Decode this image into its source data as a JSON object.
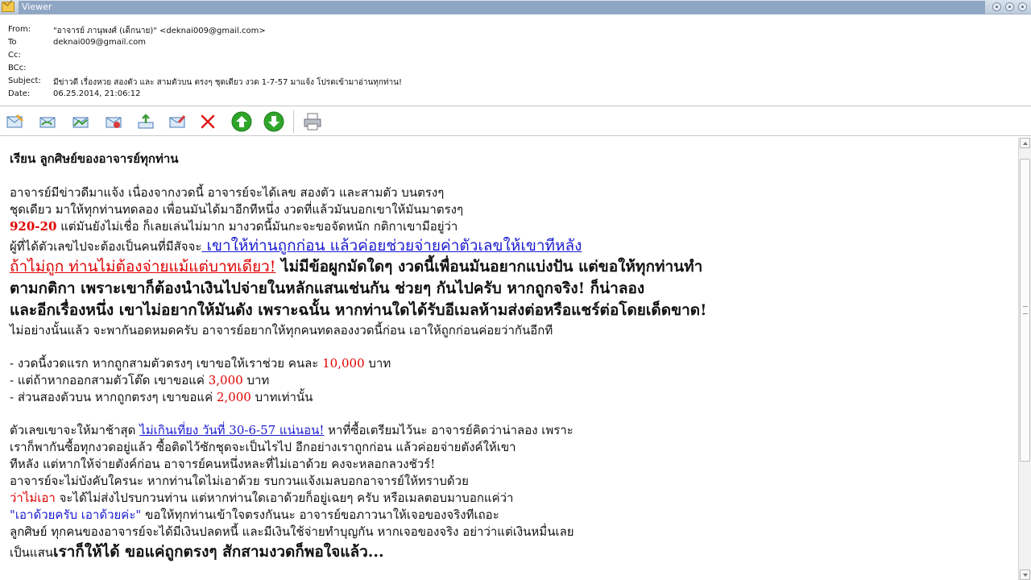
{
  "window": {
    "title": "Viewer"
  },
  "header": {
    "from_label": "From:",
    "from_value": "\"อาจารย์ ภานุพงศ์ (เด็กนาย)\" <deknai009@gmail.com>",
    "to_label": "To",
    "to_value": "deknai009@gmail.com",
    "cc_label": "Cc:",
    "cc_value": "",
    "bcc_label": "BCc:",
    "bcc_value": "",
    "subject_label": "Subject:",
    "subject_value": "มีข่าวดี เรื่องหวย สองตัว และ สามตัวบน ตรงๆ ชุดเดียว งวด 1-7-57 มาแจ้ง โปรดเข้ามาอ่านทุกท่าน!",
    "date_label": "Date:",
    "date_value": "06.25.2014, 21:06:12"
  },
  "toolbar": {
    "items": [
      {
        "icon": "compose-icon"
      },
      {
        "icon": "reply-icon"
      },
      {
        "icon": "reply-all-icon"
      },
      {
        "icon": "forward-icon"
      },
      {
        "icon": "export-icon"
      },
      {
        "icon": "edit-icon"
      },
      {
        "icon": "delete-icon"
      },
      {
        "icon": "previous-up-icon"
      },
      {
        "icon": "next-down-icon"
      },
      {
        "icon": "print-icon"
      }
    ],
    "colors": {
      "delete": "#e01818",
      "nav_green": "#2fa52a"
    }
  },
  "body": {
    "greeting": "เรียน  ลูกศิษย์ของอาจารย์ทุกท่าน",
    "p1_line1": "อาจารย์มีข่าวดีมาแจ้ง เนื่องจากงวดนี้ อาจารย์จะได้เลข สองตัว และสามตัว บนตรงๆ",
    "p1_line2": "ชุดเดียว มาให้ทุกท่านทดลอง เพื่อนมันได้มาอีกทีหนึ่ง งวดที่แล้วมันบอกเขาให้มันมาตรงๆ",
    "p1_line3_num": "920-20",
    "p1_line3_rest": "  แต่มันยังไม่เชื่อ ก็เลยเล่นไม่มาก มางวดนี้มันกะจะขอจัดหนัก กติกาเขามีอยู่ว่า",
    "p1_line4_a": "ผู้ที่ได้ตัวเลขไปจะต้องเป็นคนที่มีสัจจะ",
    "p1_line4_b": " เขาให้ท่านถูกก่อน แล้วค่อยช่วยจ่ายค่าตัวเลขให้เขาทีหลัง",
    "p1_line5_a": "ถ้าไม่ถูก ท่านไม่ต้องจ่ายแม้แต่บาทเดียว!",
    "p1_line5_b": "  ไม่มีข้อผูกมัดใดๆ งวดนี้เพื่อนมันอยากแบ่งปัน แต่ขอให้ทุกท่านทำ",
    "p1_line6": "ตามกติกา เพราะเขาก็ต้องนำเงินไปจ่ายในหลักแสนเช่นกัน ช่วยๆ กันไปครับ หากถูกจริง! ก็น่าลอง",
    "p1_line7": "และอีกเรื่องหนึ่ง เขาไม่อยากให้มันดัง เพราะฉนั้น หากท่านใดได้รับอีเมลห้ามส่งต่อหรือแชร์ต่อโดยเด็ดขาด!",
    "p1_line8": "ไม่อย่างนั้นแล้ว จะพากันอดหมดครับ  อาจารย์อยากให้ทุกคนทดลองงวดนี้ก่อน เอาให้ถูกก่อนค่อยว่ากันอีกที",
    "b1_a": "- งวดนี้งวดแรก หากถูกสามตัวตรงๆ เขาขอให้เราช่วย คนละ ",
    "b1_num": "10,000",
    "b1_b": " บาท",
    "b2_a": "- แต่ถ้าหากออกสามตัวโต๊ด เขาขอแค่ ",
    "b2_num": "3,000",
    "b2_b": " บาท",
    "b3_a": "- ส่วนสองตัวบน หากถูกตรงๆ เขาขอแค่ ",
    "b3_num": "2,000",
    "b3_b": " บาทเท่านั้น",
    "p3_line1_a": "ตัวเลขเขาจะให้มาช้าสุด ",
    "p3_line1_link": "ไม่เกินเที่ยง วันที่ 30-6-57 แน่นอน!",
    "p3_line1_b": "  หาที่ซื้อเตรียมไว้นะ อาจารย์คิดว่าน่าลอง เพราะ",
    "p3_line2": "เราก็พากันซื้อทุกงวดอยู่แล้ว ซื้อติดไว้ซักชุดจะเป็นไรไป อีกอย่างเราถูกก่อน แล้วค่อยจ่ายตังค์ให้เขา",
    "p3_line3": "ทีหลัง  แต่หากให้จ่ายตังค์ก่อน อาจารย์คนหนึ่งหละที่ไม่เอาด้วย คงจะหลอกลวงชัวร์!",
    "p3_line4": "อาจารย์จะไม่บังคับใครนะ หากท่านใดไม่เอาด้วย รบกวนแจ้งเมลบอกอาจารย์ให้ทราบด้วย",
    "p3_line5_a": "ว่าไม่เอา",
    "p3_line5_b": " จะได้ไม่ส่งไปรบกวนท่าน  แต่หากท่านใดเอาด้วยก็อยู่เฉยๆ ครับ หรือเมลตอบมาบอกแค่ว่า",
    "p3_line6_a": "\"เอาด้วยครับ เอาด้วยค่ะ\"",
    "p3_line6_b": "  ขอให้ทุกท่านเข้าใจตรงกันนะ   อาจารย์ขอภาวนาให้เจอของจริงทีเถอะ",
    "p3_line7": "ลูกศิษย์ ทุกคนของอาจารย์จะได้มีเงินปลดหนี้ และมีเงินใช้จ่ายทำบุญกัน หากเจอของจริง อย่าว่าแต่เงินหมื่นเลย",
    "p3_line8_a": "เป็นแสน",
    "p3_line8_b": "เราก็ให้ได้ ขอแค่ถูกตรงๆ สักสามงวดก็พอใจแล้ว..."
  }
}
